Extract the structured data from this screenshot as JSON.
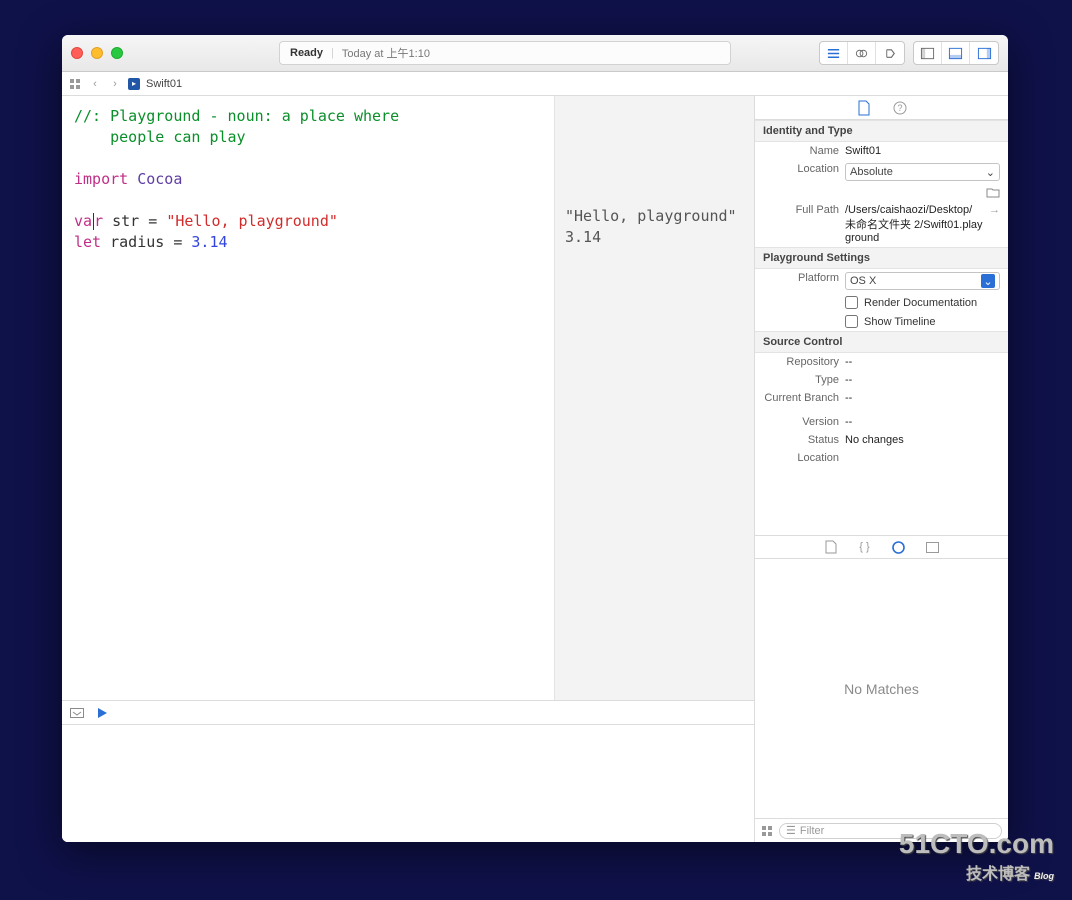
{
  "status": {
    "ready": "Ready",
    "time": "Today at 上午1:10"
  },
  "tab": {
    "filename": "Swift01"
  },
  "code": {
    "comment1": "//: Playground - noun: a place where",
    "comment2": "    people can play",
    "importKw": "import",
    "importMod": "Cocoa",
    "varKw": "var",
    "varName": " str = ",
    "varStr": "\"Hello, playground\"",
    "letKw": "let",
    "letName": " radius = ",
    "letNum": "3.14"
  },
  "results": {
    "line1": "\"Hello, playground\"",
    "line2": "3.14"
  },
  "inspector": {
    "identity": {
      "header": "Identity and Type",
      "nameLabel": "Name",
      "nameValue": "Swift01",
      "locationLabel": "Location",
      "locationValue": "Absolute",
      "fullPathLabel": "Full Path",
      "fullPathValue": "/Users/caishaozi/Desktop/未命名文件夹 2/Swift01.playground"
    },
    "settings": {
      "header": "Playground Settings",
      "platformLabel": "Platform",
      "platformValue": "OS X",
      "renderDoc": "Render Documentation",
      "showTimeline": "Show Timeline"
    },
    "sourceControl": {
      "header": "Source Control",
      "repoLabel": "Repository",
      "repoValue": "--",
      "typeLabel": "Type",
      "typeValue": "--",
      "branchLabel": "Current Branch",
      "branchValue": "--",
      "versionLabel": "Version",
      "versionValue": "--",
      "statusLabel": "Status",
      "statusValue": "No changes",
      "locationLabel": "Location"
    },
    "noMatches": "No Matches",
    "filterPlaceholder": "Filter"
  },
  "watermark": {
    "line1": "51CTO.com",
    "line2": "技术博客",
    "blog": "Blog"
  }
}
